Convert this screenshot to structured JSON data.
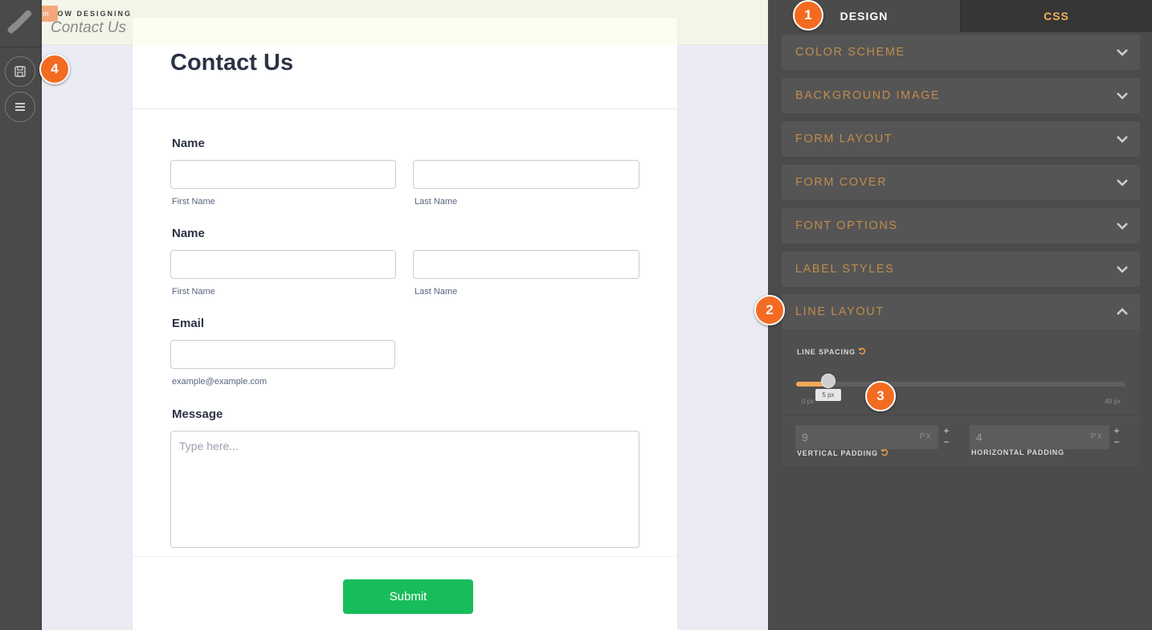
{
  "topbar": {
    "now_designing_label": "NOW DESIGNING",
    "form_name": "Contact Us",
    "orange_tab_glyph": "m"
  },
  "rail": {
    "icons": [
      "jotform-logo-icon",
      "save-icon",
      "menu-icon"
    ]
  },
  "form": {
    "title": "Contact Us",
    "fields": [
      {
        "label": "Name",
        "sublabels": [
          "First Name",
          "Last Name"
        ]
      },
      {
        "label": "Name",
        "sublabels": [
          "First Name",
          "Last Name"
        ]
      },
      {
        "label": "Email",
        "sublabels": [
          "example@example.com"
        ]
      },
      {
        "label": "Message",
        "placeholder": "Type here..."
      }
    ],
    "submit_label": "Submit"
  },
  "panel": {
    "tabs": {
      "design": "DESIGN",
      "css": "CSS"
    },
    "sections": [
      "COLOR SCHEME",
      "BACKGROUND IMAGE",
      "FORM LAYOUT",
      "FORM COVER",
      "FONT OPTIONS",
      "LABEL STYLES"
    ],
    "open_section": {
      "title": "LINE LAYOUT",
      "line_spacing_label": "LINE SPACING",
      "slider": {
        "min_label": "0 px",
        "max_label": "40 px",
        "value_label": "5 px",
        "value": 5,
        "min": 0,
        "max": 40
      },
      "vertical_padding": {
        "value": "9",
        "unit": "PX",
        "label": "VERTICAL PADDING"
      },
      "horizontal_padding": {
        "value": "4",
        "unit": "PX",
        "label": "HORIZONTAL PADDING"
      },
      "plus": "+",
      "minus": "−"
    }
  },
  "colors": {
    "accent": "#f26b21",
    "submit": "#18bd5b",
    "panel_label": "#c08c4b"
  },
  "badges": [
    "1",
    "2",
    "3",
    "4"
  ]
}
